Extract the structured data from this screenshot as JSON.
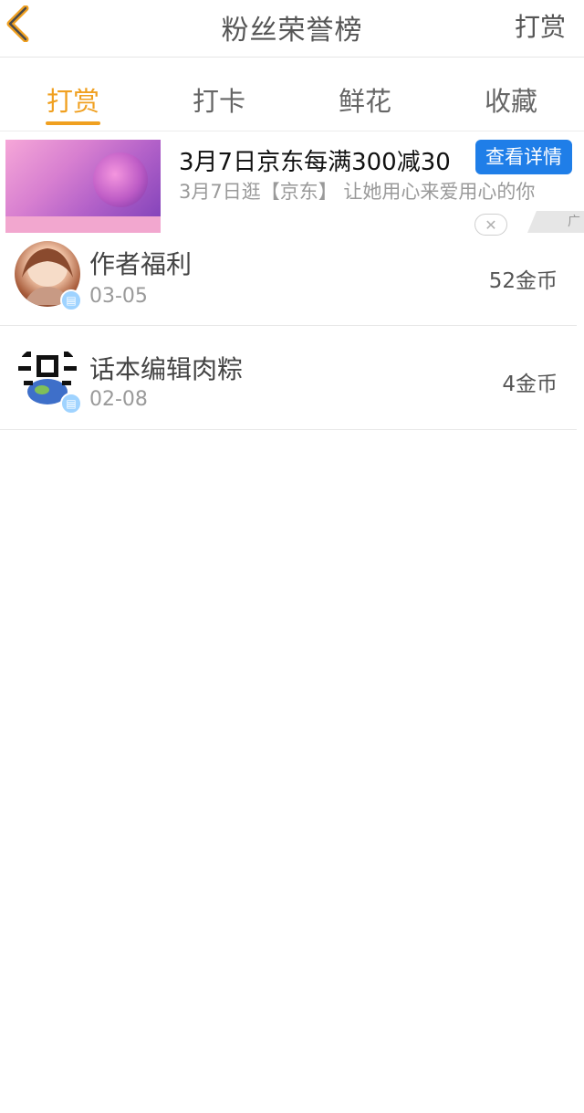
{
  "header": {
    "back_icon": "chevron-left-icon",
    "title": "粉丝荣誉榜",
    "right_action": "打赏"
  },
  "tabs": [
    {
      "label": "打赏",
      "active": true
    },
    {
      "label": "打卡",
      "active": false
    },
    {
      "label": "鲜花",
      "active": false
    },
    {
      "label": "收藏",
      "active": false
    }
  ],
  "ad": {
    "title": "3月7日京东每满300减30",
    "description": "3月7日逛【京东】 让她用心来爱用心的你",
    "button_label": "查看详情",
    "close_icon": "close-icon",
    "badge_label": "广"
  },
  "entries": [
    {
      "name": "作者福利",
      "date": "03-05",
      "amount": "52金币"
    },
    {
      "name": "话本编辑肉粽",
      "date": "02-08",
      "amount": "4金币"
    }
  ],
  "colors": {
    "accent": "#f0a020",
    "ad_button": "#1f7ee8"
  }
}
